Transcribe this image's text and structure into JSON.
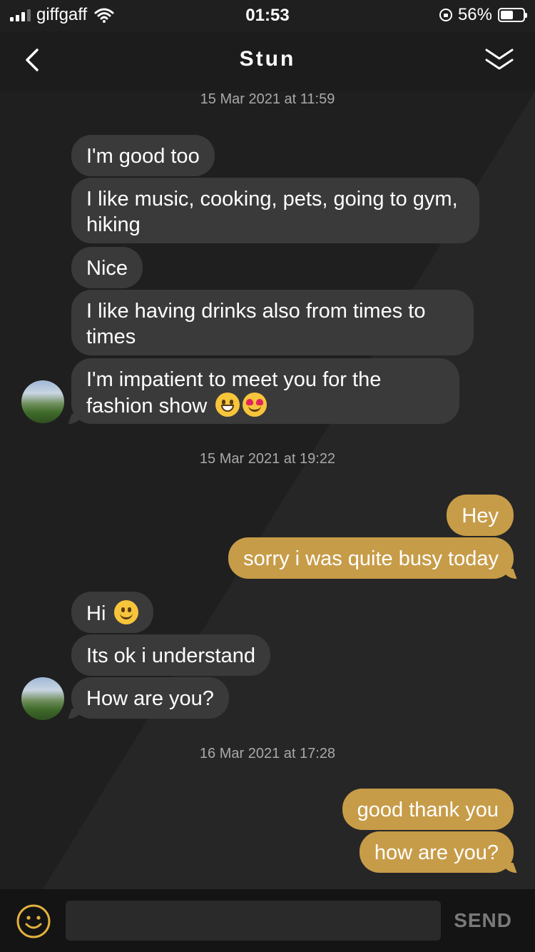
{
  "status_bar": {
    "carrier": "giffgaff",
    "time": "01:53",
    "battery_percent": "56%",
    "battery_level": 0.56,
    "icons": [
      "signal-icon",
      "wifi-icon",
      "orientation-lock-icon",
      "battery-icon"
    ]
  },
  "header": {
    "title": "Stun",
    "icons": [
      "back-chevron-icon",
      "double-chevron-down-icon"
    ]
  },
  "conversation": {
    "timestamps": [
      "15 Mar 2021 at 11:59",
      "15 Mar 2021 at 19:22",
      "16 Mar 2021 at 17:28"
    ],
    "messages": [
      {
        "dir": "in",
        "text": "I'm good too"
      },
      {
        "dir": "in",
        "text": "I like music, cooking, pets, going to gym, hiking"
      },
      {
        "dir": "in",
        "text": "Nice"
      },
      {
        "dir": "in",
        "text": "I like having drinks also from times to times"
      },
      {
        "dir": "in",
        "text": "I'm impatient to meet you for the fashion show",
        "emojis": [
          "grinning-face",
          "heart-eyes-face"
        ]
      },
      {
        "dir": "out",
        "text": "Hey"
      },
      {
        "dir": "out",
        "text": "sorry i was quite busy today"
      },
      {
        "dir": "in",
        "text": "Hi",
        "emojis": [
          "slight-smile-face"
        ]
      },
      {
        "dir": "in",
        "text": "Its ok i understand"
      },
      {
        "dir": "in",
        "text": "How are you?"
      },
      {
        "dir": "out",
        "text": "good thank you"
      },
      {
        "dir": "out",
        "text": "how are you?"
      }
    ]
  },
  "composer": {
    "value": "",
    "send_label": "SEND",
    "icon": "smiley-icon"
  },
  "colors": {
    "background": "#1f1f1f",
    "incoming_bubble": "#3a3a3a",
    "outgoing_bubble": "#c79c48",
    "accent": "#e1b13c"
  }
}
